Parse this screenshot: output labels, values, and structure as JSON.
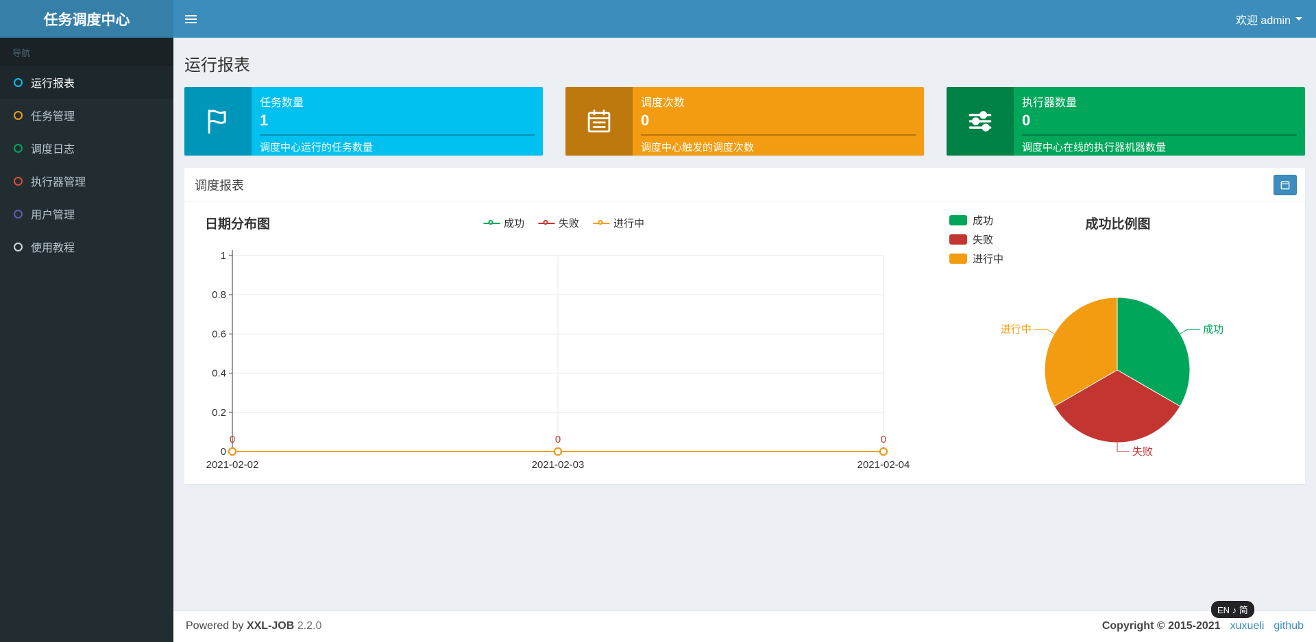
{
  "header": {
    "logo": "任务调度中心",
    "welcome": "欢迎 admin"
  },
  "sidebar": {
    "nav_label": "导航",
    "items": [
      {
        "label": "运行报表",
        "color": "#00c0ef",
        "active": true
      },
      {
        "label": "任务管理",
        "color": "#f39c12",
        "active": false
      },
      {
        "label": "调度日志",
        "color": "#00a65a",
        "active": false
      },
      {
        "label": "执行器管理",
        "color": "#dd4b39",
        "active": false
      },
      {
        "label": "用户管理",
        "color": "#605ca8",
        "active": false
      },
      {
        "label": "使用教程",
        "color": "#d2d6de",
        "active": false
      }
    ]
  },
  "main": {
    "page_title": "运行报表",
    "info_boxes": [
      {
        "title": "任务数量",
        "number": "1",
        "desc": "调度中心运行的任务数量",
        "bg": "#00c0ef",
        "icon": "flag-icon"
      },
      {
        "title": "调度次数",
        "number": "0",
        "desc": "调度中心触发的调度次数",
        "bg": "#f39c12",
        "icon": "calendar-icon"
      },
      {
        "title": "执行器数量",
        "number": "0",
        "desc": "调度中心在线的执行器机器数量",
        "bg": "#00a65a",
        "icon": "sliders-icon"
      }
    ],
    "panel_title": "调度报表",
    "date_range_button_icon": "calendar-icon"
  },
  "chart_data": [
    {
      "type": "line",
      "title": "日期分布图",
      "x": [
        "2021-02-02",
        "2021-02-03",
        "2021-02-04"
      ],
      "series": [
        {
          "name": "成功",
          "color": "#00a65a",
          "values": [
            0,
            0,
            0
          ]
        },
        {
          "name": "失败",
          "color": "#c23531",
          "values": [
            0,
            0,
            0
          ]
        },
        {
          "name": "进行中",
          "color": "#f39c12",
          "values": [
            0,
            0,
            0
          ]
        }
      ],
      "ylim": [
        0,
        1
      ],
      "yticks": [
        0,
        0.2,
        0.4,
        0.6,
        0.8,
        1
      ],
      "point_labels": {
        "values": [
          "0",
          "0",
          "0"
        ],
        "color": "#c23531"
      },
      "legend_position": "top",
      "grid": true
    },
    {
      "type": "pie",
      "title": "成功比例图",
      "slices": [
        {
          "name": "成功",
          "value": 33.33,
          "color": "#00a65a"
        },
        {
          "name": "失败",
          "value": 33.33,
          "color": "#c23531"
        },
        {
          "name": "进行中",
          "value": 33.33,
          "color": "#f39c12"
        }
      ],
      "legend_position": "left-top"
    }
  ],
  "footer": {
    "powered_prefix": "Powered by",
    "brand": "XXL-JOB",
    "version": "2.2.0",
    "copyright": "Copyright © 2015-2021",
    "links": [
      {
        "label": "xuxueli"
      },
      {
        "label": "github"
      }
    ]
  },
  "ime_badge": "EN ♪ 简",
  "colors": {
    "navbar": "#3c8dbc",
    "logo_bg": "#367fa9",
    "sidebar_bg": "#222d32",
    "body_bg": "#ecf0f5"
  }
}
